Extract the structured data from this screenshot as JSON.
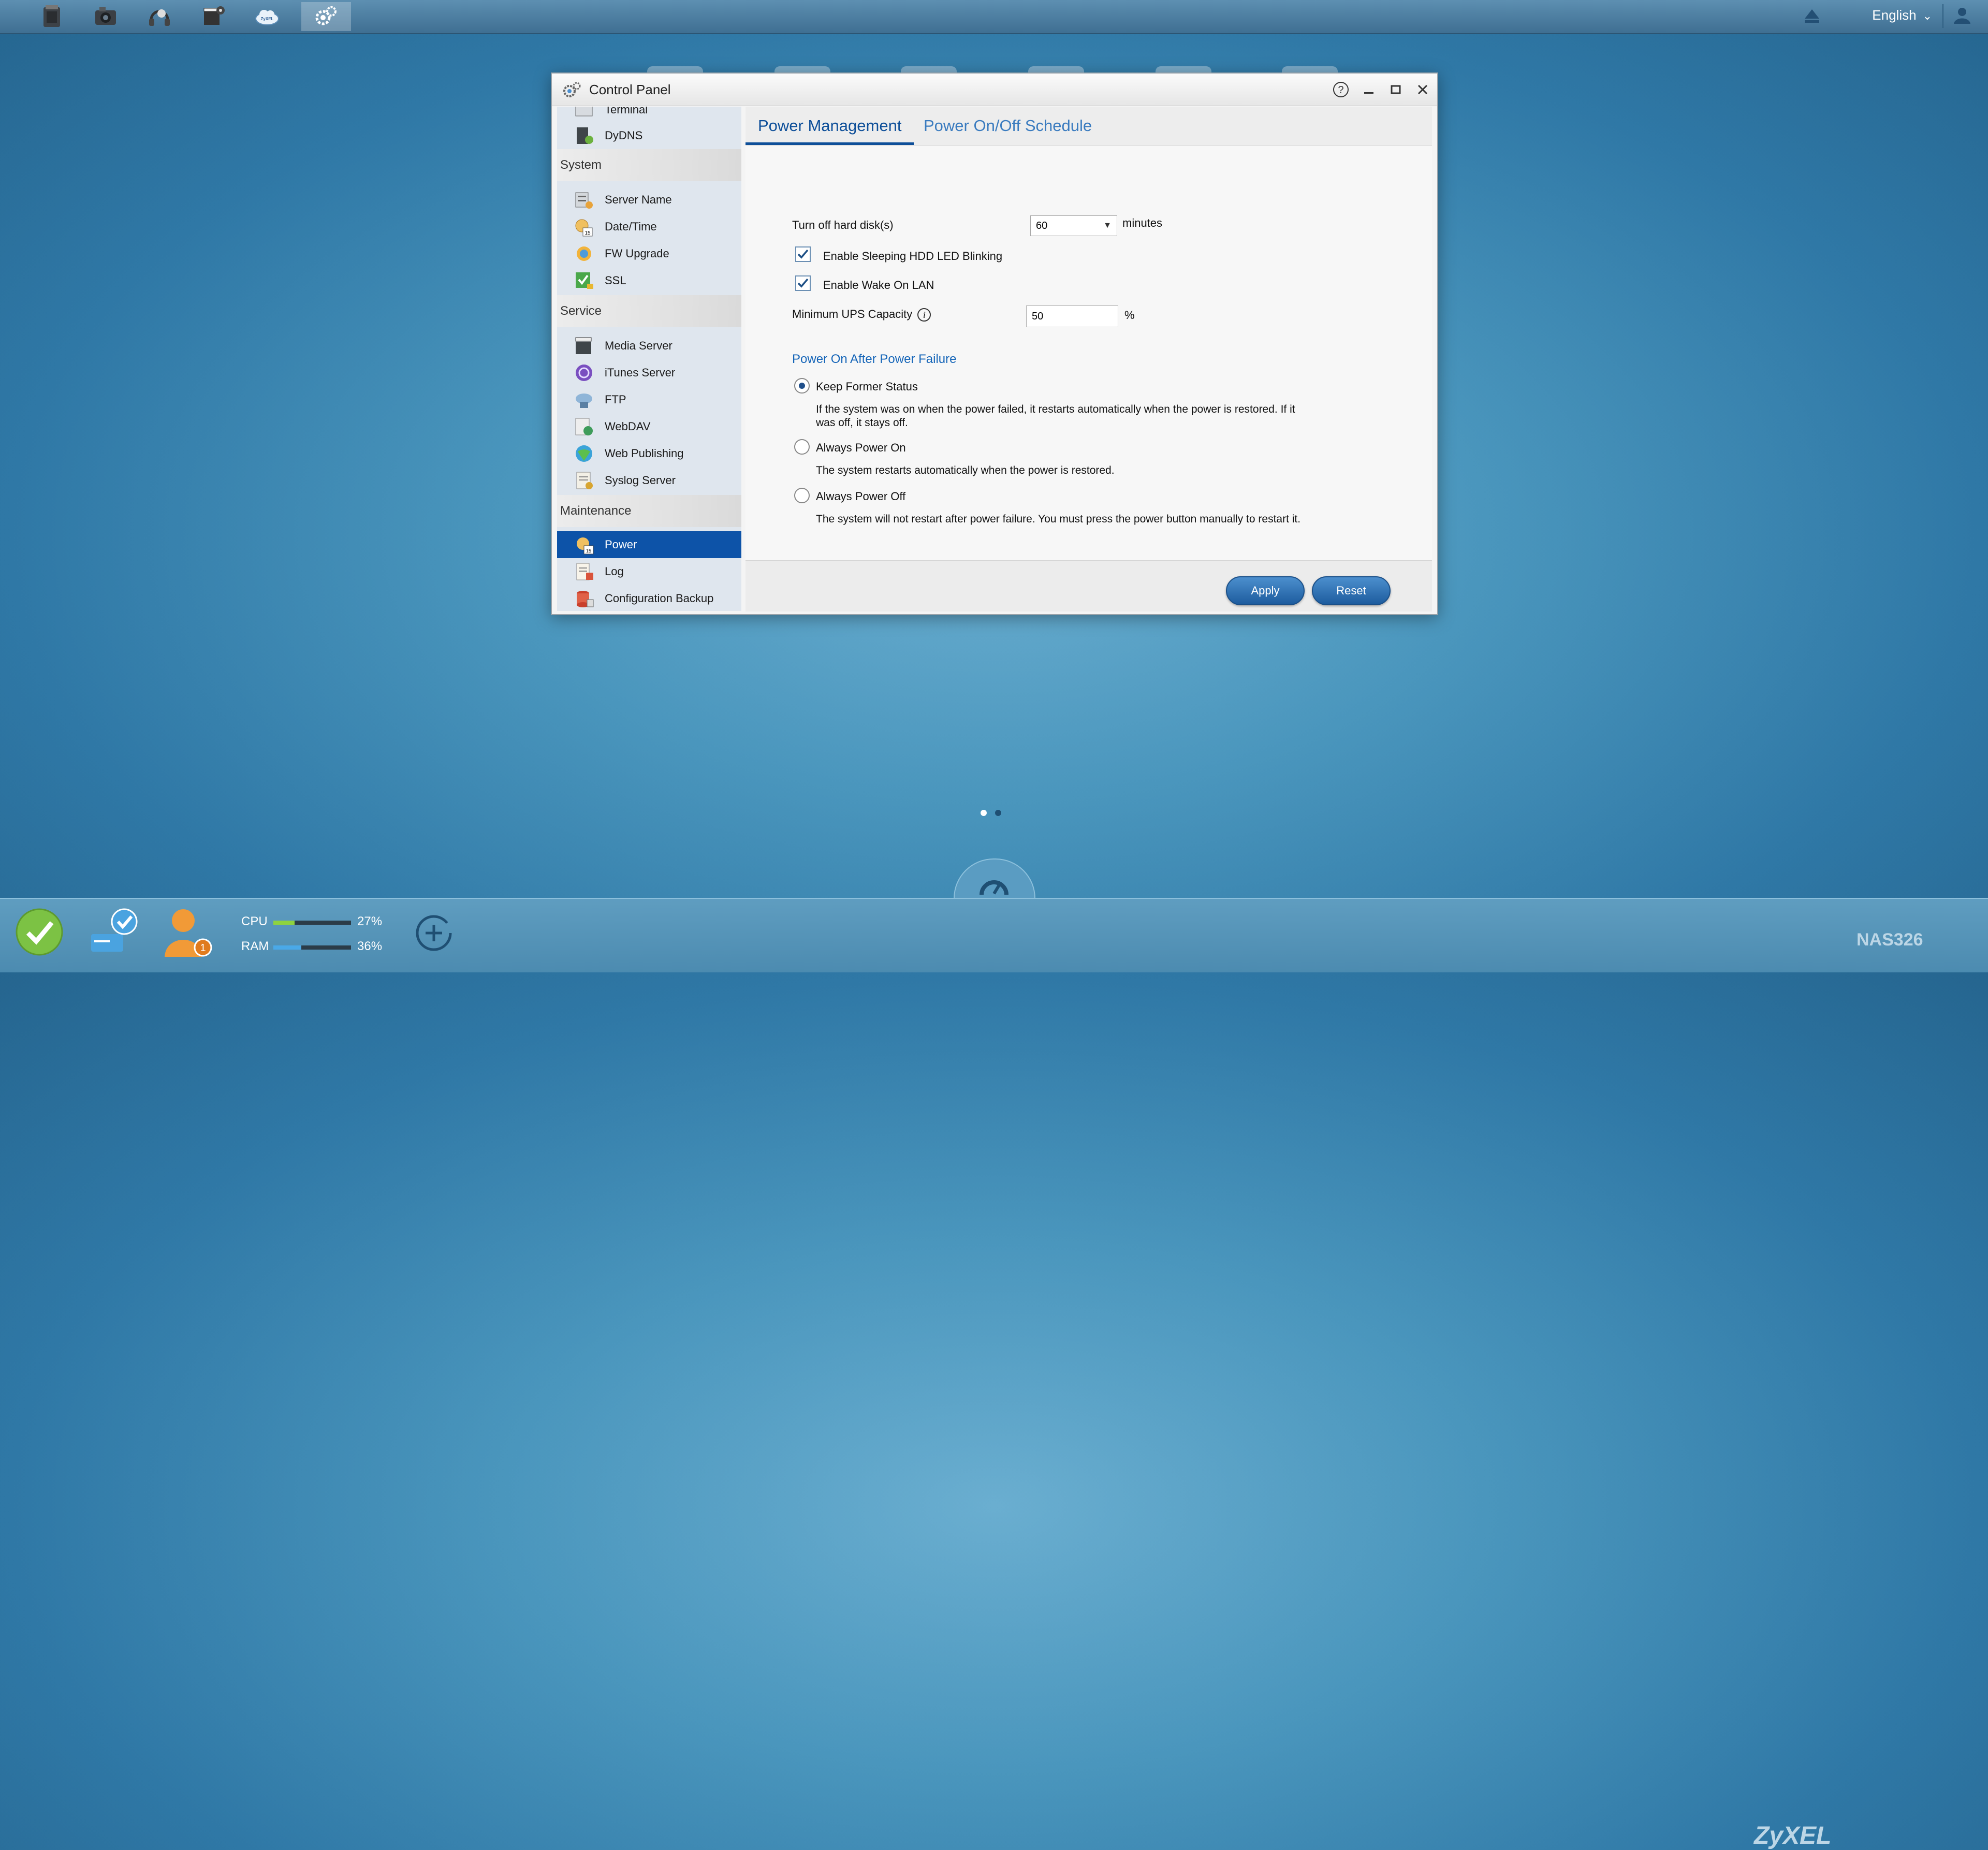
{
  "topbar": {
    "apps": [
      {
        "icon": "file-browser-icon"
      },
      {
        "icon": "photo-icon"
      },
      {
        "icon": "music-icon"
      },
      {
        "icon": "video-icon"
      },
      {
        "icon": "zyxel-cloud-icon"
      },
      {
        "icon": "control-panel-icon"
      }
    ],
    "language": "English"
  },
  "window": {
    "title": "Control Panel"
  },
  "sidebar": {
    "items_top": [
      {
        "label": "Terminal",
        "icon": "terminal-icon"
      },
      {
        "label": "DyDNS",
        "icon": "dydns-icon"
      }
    ],
    "system_header": "System",
    "system_items": [
      {
        "label": "Server Name",
        "icon": "server-name-icon"
      },
      {
        "label": "Date/Time",
        "icon": "calendar-icon"
      },
      {
        "label": "FW Upgrade",
        "icon": "fw-upgrade-icon"
      },
      {
        "label": "SSL",
        "icon": "ssl-icon"
      }
    ],
    "service_header": "Service",
    "service_items": [
      {
        "label": "Media Server",
        "icon": "media-server-icon"
      },
      {
        "label": "iTunes Server",
        "icon": "itunes-icon"
      },
      {
        "label": "FTP",
        "icon": "ftp-icon"
      },
      {
        "label": "WebDAV",
        "icon": "webdav-icon"
      },
      {
        "label": "Web Publishing",
        "icon": "web-publishing-icon"
      },
      {
        "label": "Syslog Server",
        "icon": "syslog-icon"
      }
    ],
    "maintenance_header": "Maintenance",
    "maintenance_items": [
      {
        "label": "Power",
        "icon": "power-icon",
        "selected": true
      },
      {
        "label": "Log",
        "icon": "log-icon"
      },
      {
        "label": "Configuration Backup",
        "icon": "backup-icon"
      }
    ]
  },
  "tabs": [
    {
      "label": "Power Management",
      "active": true
    },
    {
      "label": "Power On/Off Schedule",
      "active": false
    }
  ],
  "form": {
    "hdd_label": "Turn off hard disk(s)",
    "hdd_value": "60",
    "hdd_unit": "minutes",
    "led_label": "Enable Sleeping HDD LED Blinking",
    "led_checked": true,
    "wol_label": "Enable Wake On LAN",
    "wol_checked": true,
    "ups_label": "Minimum UPS Capacity",
    "ups_info": "i",
    "ups_value": "50",
    "ups_unit": "%",
    "section_title": "Power On After Power Failure",
    "options": [
      {
        "label": "Keep Former Status",
        "selected": true,
        "desc1": "If the system was on when the power failed, it restarts automatically when the power is restored. If it",
        "desc2": "was off, it stays off."
      },
      {
        "label": "Always Power On",
        "selected": false,
        "desc1": "The system restarts automatically when the power is restored."
      },
      {
        "label": "Always Power Off",
        "selected": false,
        "desc1": "The system will not restart after power failure. You must press the power button manually to restart it."
      }
    ],
    "apply_label": "Apply",
    "reset_label": "Reset"
  },
  "status": {
    "cpu_label": "CPU",
    "cpu_value": "27%",
    "cpu_fraction": 0.27,
    "ram_label": "RAM",
    "ram_value": "36%",
    "ram_fraction": 0.36,
    "user_badge": "1",
    "brand": "ZyXEL",
    "model": "NAS326"
  },
  "colors": {
    "accent": "#0d53a8",
    "cpu_bar": "#8ed33f",
    "ram_bar": "#4aa9e8"
  }
}
